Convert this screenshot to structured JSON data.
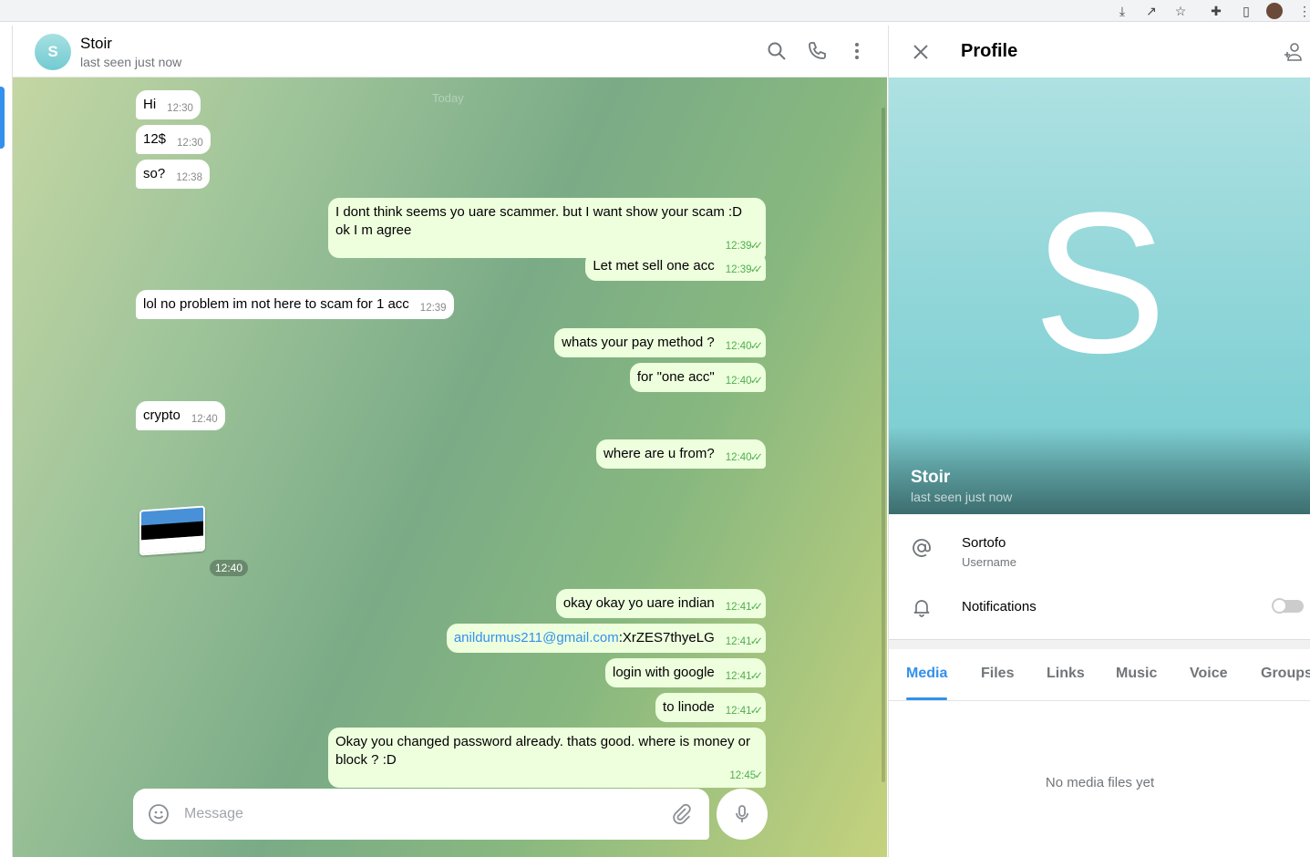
{
  "chat": {
    "name": "Stoir",
    "status": "last seen just now",
    "avatar_letter": "S",
    "date_label": "Today",
    "messages": [
      {
        "side": "in",
        "text": "Hi",
        "time": "12:30"
      },
      {
        "side": "in",
        "text": "12$",
        "time": "12:30"
      },
      {
        "side": "in",
        "text": "so?",
        "time": "12:38"
      },
      {
        "side": "out",
        "text": "I dont think seems yo uare scammer. but I want show your scam :D ok I m agree",
        "time": "12:39",
        "check": "double"
      },
      {
        "side": "out",
        "text": "Let met sell one acc",
        "time": "12:39",
        "check": "double"
      },
      {
        "side": "in",
        "text": "lol no problem im not here to scam for 1 acc",
        "time": "12:39"
      },
      {
        "side": "out",
        "text": "whats your pay method ?",
        "time": "12:40",
        "check": "double"
      },
      {
        "side": "out",
        "text": "for \"one acc\"",
        "time": "12:40",
        "check": "double"
      },
      {
        "side": "in",
        "text": "crypto",
        "time": "12:40"
      },
      {
        "side": "out",
        "text": "where are u from?",
        "time": "12:40",
        "check": "double"
      },
      {
        "side": "out",
        "text": "okay okay yo uare indian",
        "time": "12:41",
        "check": "double"
      },
      {
        "side": "out",
        "link": "anildurmus211@gmail.com",
        "text": ":XrZES7thyeLG",
        "time": "12:41",
        "check": "double"
      },
      {
        "side": "out",
        "text": "login with google",
        "time": "12:41",
        "check": "double"
      },
      {
        "side": "out",
        "text": "to linode",
        "time": "12:41",
        "check": "double"
      },
      {
        "side": "out",
        "text": "Okay you changed password already. thats good. where is money or block ? :D",
        "time": "12:45",
        "check": "single"
      }
    ],
    "sticker": {
      "emoji": "flag-estonia",
      "colors": [
        "#4891d9",
        "#000000",
        "#ffffff"
      ],
      "time": "12:40"
    },
    "composer": {
      "placeholder": "Message"
    }
  },
  "profile": {
    "title": "Profile",
    "avatar_letter": "S",
    "name": "Stoir",
    "status": "last seen just now",
    "username": "Sortofo",
    "username_label": "Username",
    "notifications_label": "Notifications",
    "notifications_on": false,
    "tabs": [
      "Media",
      "Files",
      "Links",
      "Music",
      "Voice",
      "Groups"
    ],
    "active_tab": "Media",
    "empty_text": "No media files yet"
  },
  "colors": {
    "accent": "#3390ec",
    "outgoing_bubble": "#eeffde",
    "time_out": "#4fae4e"
  }
}
